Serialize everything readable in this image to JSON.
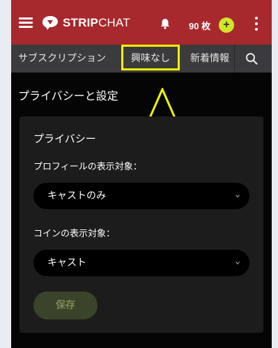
{
  "header": {
    "brand_bold": "STRIP",
    "brand_light": "CHAT",
    "tokens": "90 枚",
    "plus": "+"
  },
  "tabs": [
    {
      "label": "サブスクリプション"
    },
    {
      "label": "興味なし"
    },
    {
      "label": "新着情報"
    }
  ],
  "page": {
    "title": "プライバシーと設定"
  },
  "privacy_card": {
    "title": "プライバシー",
    "profile_label": "プロフィールの表示対象：",
    "profile_value": "キャストのみ",
    "coin_label": "コインの表示対象：",
    "coin_value": "キャスト",
    "save_label": "保存"
  },
  "colors": {
    "header_bg": "#a7282d",
    "tab_bg": "#3b3b3d",
    "highlight": "#f5f500",
    "plus_bg": "#cfe628"
  }
}
